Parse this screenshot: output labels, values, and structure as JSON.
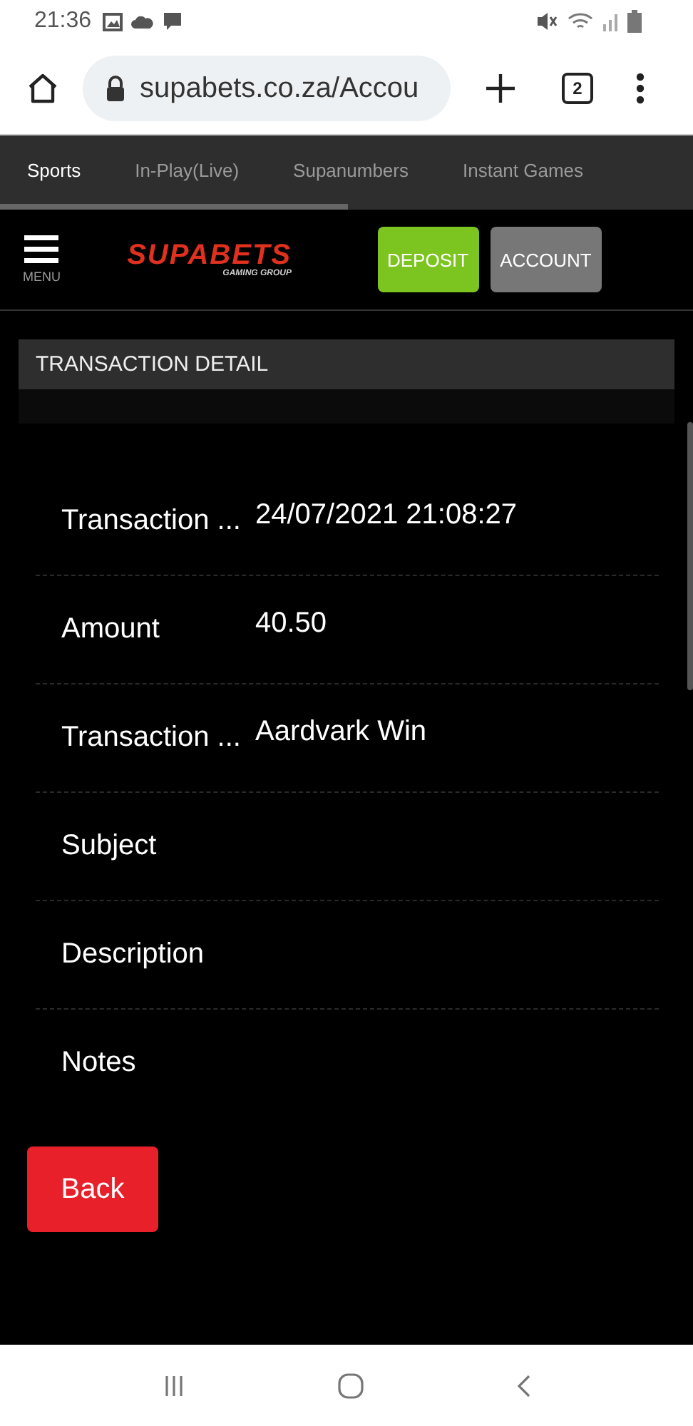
{
  "status_bar": {
    "time": "21:36"
  },
  "browser": {
    "url": "supabets.co.za/Accou",
    "tab_count": "2"
  },
  "nav_tabs": [
    {
      "label": "Sports",
      "selected": true
    },
    {
      "label": "In-Play(Live)",
      "selected": false
    },
    {
      "label": "Supanumbers",
      "selected": false
    },
    {
      "label": "Instant Games",
      "selected": false
    }
  ],
  "header": {
    "menu_label": "MENU",
    "logo": "SUPABETS",
    "logo_tagline": "GAMING GROUP",
    "buttons": [
      {
        "label": "DEPOSIT",
        "kind": "primary"
      },
      {
        "label": "ACCOUNT",
        "kind": "secondary"
      }
    ]
  },
  "panel_title": "TRANSACTION DETAIL",
  "details": [
    {
      "label": "Transaction ...",
      "value": "24/07/2021 21:08:27"
    },
    {
      "label": "Amount",
      "value": "40.50"
    },
    {
      "label": "Transaction ...",
      "value": "Aardvark Win"
    },
    {
      "label": "Subject"
    },
    {
      "label": "Description"
    },
    {
      "label": "Notes"
    }
  ],
  "back_button": "Back"
}
